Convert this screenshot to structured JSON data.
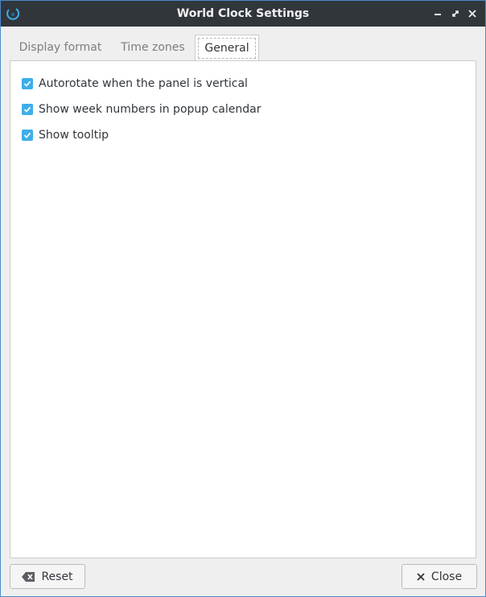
{
  "window": {
    "title": "World Clock Settings"
  },
  "tabs": [
    {
      "label": "Display format"
    },
    {
      "label": "Time zones"
    },
    {
      "label": "General"
    }
  ],
  "general": {
    "options": [
      {
        "label": "Autorotate when the panel is vertical",
        "checked": true
      },
      {
        "label": "Show week numbers in popup calendar",
        "checked": true
      },
      {
        "label": "Show tooltip",
        "checked": true
      }
    ]
  },
  "buttons": {
    "reset": "Reset",
    "close": "Close"
  },
  "colors": {
    "accent": "#3daee9",
    "titlebar": "#31363b",
    "window_border": "#4a8cc7"
  },
  "icons": {
    "app": "world-clock-icon",
    "minimize": "minimize-icon",
    "maximize": "maximize-icon",
    "close": "close-icon",
    "reset": "clear-icon",
    "close_button": "x-icon"
  }
}
